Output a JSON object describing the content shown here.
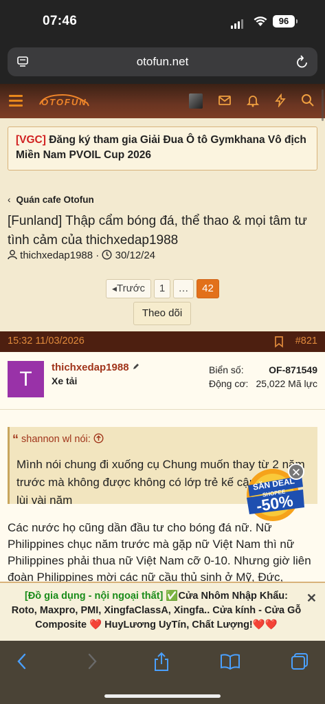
{
  "status": {
    "time": "07:46",
    "battery": "96"
  },
  "browser": {
    "url": "otofun.net"
  },
  "site": {
    "logo": "OTOFUN"
  },
  "notice": {
    "tag": "[VGC]",
    "text": " Đăng ký tham gia Giải Đua Ô tô Gymkhana Vô địch Miền Nam PVOIL Cup 2026"
  },
  "breadcrumb": "Quán cafe Otofun",
  "thread": {
    "title": "[Funland] Thập cẩm bóng đá, thể thao & mọi tâm tư tình cảm của thichxedap1988",
    "author": "thichxedap1988",
    "date": "30/12/24"
  },
  "pagination": {
    "prev": "Trước",
    "first": "1",
    "ellipsis": "…",
    "current": "42"
  },
  "follow_label": "Theo dõi",
  "post": {
    "datetime": "15:32 11/03/2026",
    "number": "#821",
    "avatar_letter": "T",
    "username": "thichxedap1988",
    "role": "Xe tải",
    "stats": [
      {
        "label": "Biển số:",
        "value": "OF-871549"
      },
      {
        "label": "Động cơ:",
        "value": "25,022 Mã lực"
      }
    ],
    "quote": {
      "author": "shannon wl nói:",
      "text": "Mình nói chung đi xuống cụ Chung muốn thay từ 2 năm trước mà không được không có lớp trẻ kế cận thì sẽ đi lùi vài năm"
    },
    "body": "Các nước họ cũng dần đầu tư cho bóng đá nữ. Nữ Philippines chục năm trước mà gặp nữ Việt Nam thì nữ Philippines phải thua nữ Việt Nam cỡ 0-10. Nhưng giờ liên đoàn Philippines mời các nữ cầu thủ sinh ở Mỹ, Đức,"
  },
  "promo": {
    "line1": "SĂN DEAL",
    "line2": "SHOPEE",
    "discount": "-50%"
  },
  "ad": {
    "tag": "[Đồ gia dụng - nội ngoại thất]",
    "text": " ✅Cửa Nhôm Nhập Khẩu: Roto, Maxpro, PMI, XingfaClassA, Xingfa.. Cửa kính - Cửa Gỗ Composite ❤️ HuyLương UyTín, Chất Lượng!❤️❤️",
    "close": "✕"
  },
  "colors": {
    "accent": "#e2701a",
    "header": "#6a3522",
    "username": "#a0341a",
    "avatar": "#9932a8"
  }
}
